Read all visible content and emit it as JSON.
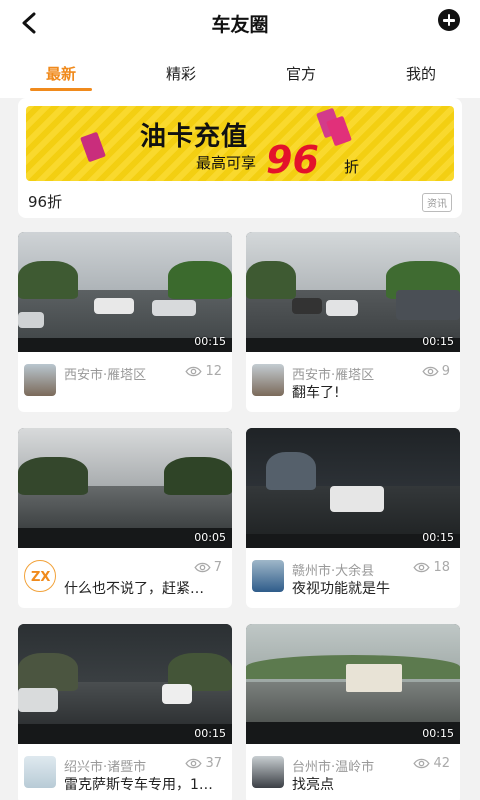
{
  "header": {
    "title": "车友圈",
    "back_icon": "back-arrow-icon",
    "add_icon": "plus-circle-icon"
  },
  "tabs": [
    {
      "label": "最新",
      "active": true
    },
    {
      "label": "精彩",
      "active": false
    },
    {
      "label": "官方",
      "active": false
    },
    {
      "label": "我的",
      "active": false
    }
  ],
  "banner": {
    "main_text": "油卡充值",
    "sub_text": "最高可享",
    "discount_num": "96",
    "discount_unit": "折",
    "caption": "96折",
    "badge": "资讯"
  },
  "posts": [
    {
      "location": "西安市·雁塔区",
      "views": "12",
      "caption": "",
      "duration": "00:15"
    },
    {
      "location": "西安市·雁塔区",
      "views": "9",
      "caption": "翻车了!",
      "duration": "00:15"
    },
    {
      "location": "",
      "views": "7",
      "caption": "什么也不说了，赶紧…",
      "duration": "00:05"
    },
    {
      "location": "赣州市·大余县",
      "views": "18",
      "caption": "夜视功能就是牛",
      "duration": "00:15"
    },
    {
      "location": "绍兴市·诸暨市",
      "views": "37",
      "caption": "雷克萨斯专车专用，1…",
      "duration": "00:15"
    },
    {
      "location": "台州市·温岭市",
      "views": "42",
      "caption": "找亮点",
      "duration": "00:15"
    }
  ],
  "colors": {
    "accent": "#f08a1c",
    "discount_red": "#e3122b"
  }
}
